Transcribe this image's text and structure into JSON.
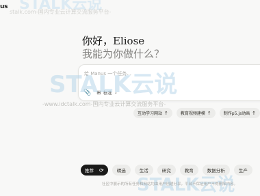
{
  "app": {
    "logo_text": "us"
  },
  "greeting": {
    "line1": "你好，Eliose",
    "line2": "我能为你做什么？"
  },
  "input": {
    "placeholder": "给 Manus 一个任务...",
    "attach_icon": "paperclip-icon",
    "mode_label": "标准",
    "mode_icon": "squares-icon"
  },
  "suggestions": [
    {
      "label": "互动学习网站"
    },
    {
      "label": "教育视频建模"
    },
    {
      "label": "制作p5.js动画"
    }
  ],
  "tabs": {
    "active_label": "推荐",
    "refresh_icon": "refresh-icon",
    "items": [
      "精选",
      "生活",
      "研究",
      "教育",
      "数据分析",
      "生产"
    ]
  },
  "footer": {
    "text": "社区中展示的所有任务和网站均由用户创建分享，平台不保证用户不得删除内容。"
  },
  "watermark": {
    "brand": "STALK云说",
    "top": "stalk.com-国内专业云计算交流服务平台-",
    "mid_sub": "-www.idctalk.com-国内专业云计算交流服务平台-"
  },
  "colors": {
    "accent_dark": "#1a1a19",
    "chip_bg": "#ececea",
    "page_bg": "#f8f8f7"
  }
}
